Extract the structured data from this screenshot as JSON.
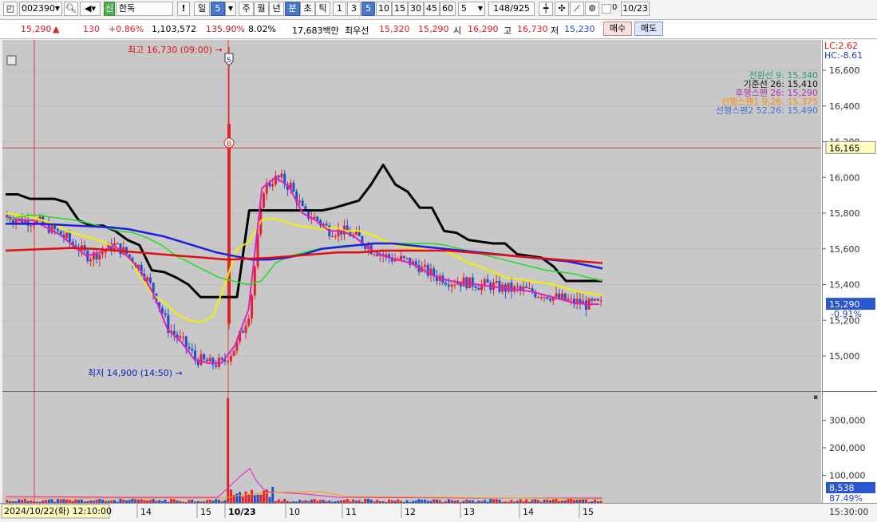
{
  "toolbar": {
    "code": "002390",
    "badge": "신",
    "name": "한독",
    "bang": "!",
    "day": "일",
    "period": "5",
    "week": "주",
    "month": "월",
    "year": "년",
    "minute": "분",
    "second": "초",
    "tick": "틱",
    "n1": "1",
    "n3": "3",
    "n5": "5",
    "n10": "10",
    "n15": "15",
    "n30": "30",
    "n45": "45",
    "n60": "60",
    "count": "5",
    "pages": "148",
    "total": "/925",
    "date": "10/23",
    "checkbox_label": "0"
  },
  "quote": {
    "price": "15,290",
    "change": "130",
    "change_pct": "+0.86%",
    "volume": "1,103,572",
    "vol_ratio": "135.90%",
    "turnover": "8.02%",
    "amount": "17,683백만",
    "best_label": "최우선",
    "best_ask": "15,320",
    "best_bid": "15,290",
    "open_label": "시",
    "open": "16,290",
    "high_label": "고",
    "high": "16,730",
    "low_label": "저",
    "low": "15,230",
    "buy": "매수",
    "sell": "매도"
  },
  "chart_data": {
    "type": "candlestick",
    "interval": "5-minute",
    "x_tick_labels": [
      "14",
      "15",
      "10/23",
      "10",
      "11",
      "12",
      "13",
      "14",
      "15"
    ],
    "y_ticks": [
      "16,600",
      "16,400",
      "16,200",
      "16,000",
      "15,800",
      "15,600",
      "15,400",
      "15,200",
      "15,000"
    ],
    "ylim": [
      14800,
      16800
    ],
    "volume_ticks": [
      "300,000",
      "200,000",
      "100,000"
    ],
    "volume_ylim": [
      0,
      400000
    ],
    "cursor_price": "16,165",
    "current_price_tag": "15,290",
    "current_pct_tag": "-0.91%",
    "volume_tag": "8,538",
    "volume_pct_tag": "87.49%",
    "lc": "LC:2.62",
    "hc": "HC:-8.61",
    "high_annotation": "최고 16,730 (09:00)",
    "low_annotation": "최저 14,900 (14:50)",
    "cursor_datetime": "2024/10/22(화) 12:10:00",
    "time_label": "15:30:00",
    "marker_s": "S",
    "marker_b": "B",
    "legend": [
      {
        "label": "전환선 9: 15,340",
        "color": "#2a9a7a"
      },
      {
        "label": "기준선 26: 15,410",
        "color": "#111111"
      },
      {
        "label": "후행스팬 26: 15,290",
        "color": "#b030b0"
      },
      {
        "label": "선행스팬1 9,26: 15,375",
        "color": "#ff8c00"
      },
      {
        "label": "선행스팬2 52,26: 15,490",
        "color": "#4a70d0"
      }
    ],
    "candle_colors": {
      "up": "#e8202a",
      "down": "#2050d0"
    },
    "series": [
      {
        "name": "기준선 26",
        "color": "#000000",
        "values": [
          15905,
          15905,
          15880,
          15880,
          15880,
          15860,
          15760,
          15730,
          15730,
          15700,
          15650,
          15620,
          15480,
          15470,
          15440,
          15400,
          15330,
          15330,
          15330,
          15330,
          15815,
          15815,
          15815,
          15815,
          15815,
          15815,
          15815,
          15830,
          15850,
          15870,
          15960,
          16070,
          15960,
          15920,
          15830,
          15830,
          15700,
          15690,
          15650,
          15640,
          15630,
          15630,
          15570,
          15560,
          15550,
          15500,
          15420,
          15420,
          15420,
          15420
        ]
      },
      {
        "name": "전환선 9",
        "color": "#f2f000",
        "values": [
          15800,
          15790,
          15780,
          15760,
          15740,
          15700,
          15680,
          15660,
          15640,
          15610,
          15560,
          15450,
          15350,
          15300,
          15240,
          15200,
          15190,
          15220,
          15400,
          15600,
          15640,
          15760,
          15770,
          15750,
          15730,
          15720,
          15710,
          15720,
          15700,
          15700,
          15680,
          15650,
          15620,
          15610,
          15600,
          15590,
          15590,
          15560,
          15520,
          15500,
          15470,
          15440,
          15430,
          15420,
          15410,
          15400,
          15380,
          15360,
          15350,
          15340
        ]
      },
      {
        "name": "후행스팬 26",
        "color": "#e020c0",
        "values": [
          15780,
          15760,
          15760,
          15720,
          15680,
          15620,
          15560,
          15580,
          15620,
          15560,
          15480,
          15340,
          15150,
          15080,
          14980,
          14960,
          14960,
          15060,
          15260,
          15940,
          16000,
          15950,
          15800,
          15760,
          15700,
          15700,
          15660,
          15600,
          15560,
          15540,
          15520,
          15480,
          15440,
          15420,
          15410,
          15400,
          15390,
          15380,
          15370,
          15360,
          15340,
          15320,
          15300,
          15290,
          15290
        ]
      },
      {
        "name": "선행스팬1 9,26",
        "color": "#22dd22",
        "values": [
          15760,
          15780,
          15790,
          15780,
          15770,
          15760,
          15740,
          15720,
          15700,
          15690,
          15660,
          15620,
          15560,
          15520,
          15480,
          15440,
          15420,
          15400,
          15420,
          15520,
          15560,
          15580,
          15600,
          15610,
          15620,
          15620,
          15630,
          15630,
          15630,
          15630,
          15630,
          15620,
          15600,
          15580,
          15560,
          15540,
          15520,
          15500,
          15480,
          15470,
          15460,
          15440,
          15420
        ]
      },
      {
        "name": "선행스팬2 52,26",
        "color": "#1f1fdf",
        "values": [
          15740,
          15740,
          15740,
          15735,
          15730,
          15725,
          15720,
          15710,
          15690,
          15670,
          15640,
          15610,
          15580,
          15560,
          15540,
          15540,
          15550,
          15570,
          15600,
          15610,
          15620,
          15630,
          15630,
          15620,
          15610,
          15600,
          15590,
          15580,
          15570,
          15560,
          15550,
          15540,
          15530,
          15510,
          15490
        ]
      },
      {
        "name": "MA",
        "color": "#e01010",
        "values": [
          15590,
          15595,
          15600,
          15605,
          15600,
          15590,
          15580,
          15570,
          15560,
          15550,
          15540,
          15545,
          15550,
          15560,
          15570,
          15580,
          15580,
          15590,
          15590,
          15590,
          15590,
          15580,
          15570,
          15560,
          15550,
          15540,
          15530,
          15520
        ]
      }
    ]
  }
}
